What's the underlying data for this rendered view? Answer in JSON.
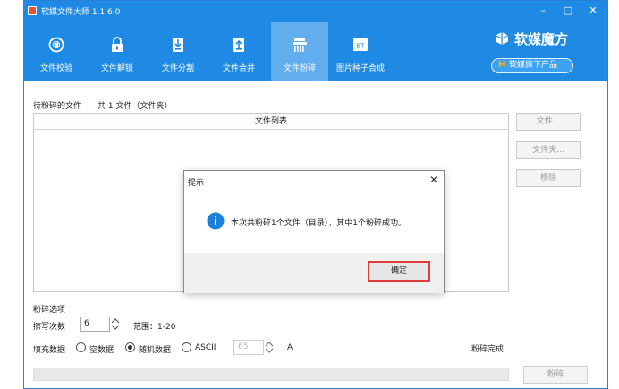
{
  "window": {
    "title": "软媒文件大师 1.1.6.0",
    "controls": {
      "minimize": "–",
      "maximize": "□",
      "close": "✕"
    }
  },
  "toolbar": {
    "items": [
      {
        "label": "文件校验",
        "icon": "checksum-icon"
      },
      {
        "label": "文件解锁",
        "icon": "unlock-icon"
      },
      {
        "label": "文件分割",
        "icon": "split-icon"
      },
      {
        "label": "文件合并",
        "icon": "merge-icon"
      },
      {
        "label": "文件粉碎",
        "icon": "shredder-icon",
        "active": true
      },
      {
        "label": "图片种子合成",
        "icon": "bt-icon",
        "icon_text": "BT"
      }
    ]
  },
  "brand": {
    "name": "软媒魔方",
    "more_products": "软媒旗下产品",
    "more_products_mark": "M"
  },
  "files": {
    "section_label": "待粉碎的文件",
    "count_text": "共 1 文件（文件夹）",
    "list_header": "文件列表"
  },
  "side_buttons": {
    "file": "文件...",
    "folder": "文件夹...",
    "remove": "移除"
  },
  "options": {
    "title": "粉碎选项",
    "overwrite_label": "擦写次数",
    "overwrite_value": "6",
    "range_text": "范围：1-20",
    "fill_label": "填充数据",
    "fill_options": [
      "空数据",
      "随机数据",
      "ASCII"
    ],
    "fill_selected": "随机数据",
    "ascii_value": "65",
    "ascii_char": "A"
  },
  "status": {
    "text": "粉碎完成",
    "progress": 0
  },
  "shred_button": "粉碎",
  "dialog": {
    "title": "提示",
    "close": "✕",
    "message": "本次共粉碎1个文件（目录），其中1个粉碎成功。",
    "ok": "确定"
  },
  "colors": {
    "header": "#1f8ae4",
    "active_tab": "#62adee",
    "highlight": "#e03a3a",
    "info": "#1e7fd9"
  }
}
